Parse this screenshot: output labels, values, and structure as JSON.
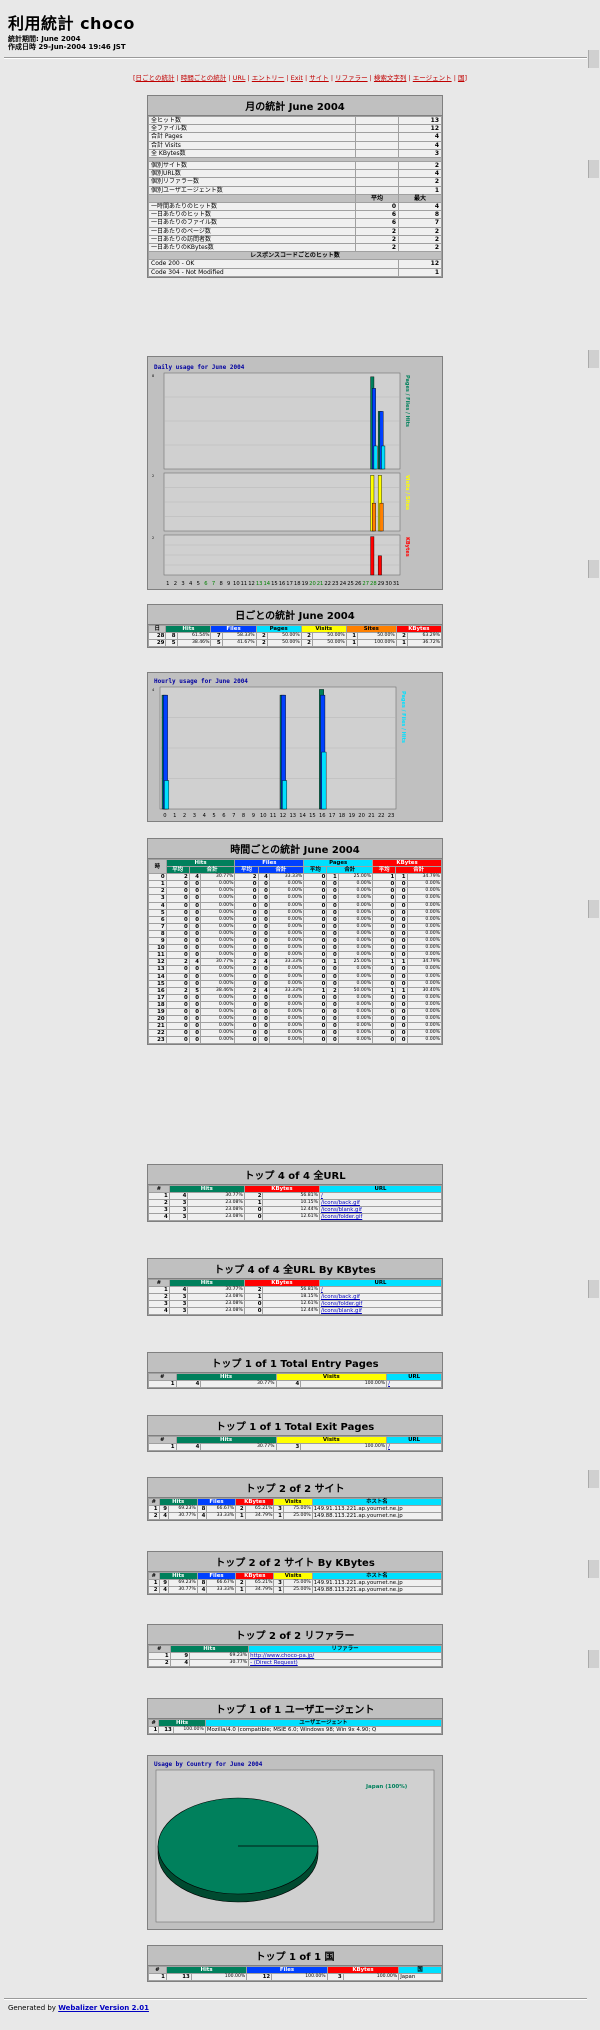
{
  "title": "利用統計 choco",
  "period_label": "統計期間: June 2004",
  "generated_label": "作成日時 29-Jun-2004 19:46 JST",
  "nav": [
    "日ごとの統計",
    "時間ごとの統計",
    "URL",
    "エントリー",
    "Exit",
    "サイト",
    "リファラー",
    "検索文字列",
    "エージェント",
    "国"
  ],
  "monthly": {
    "title": "月の統計 June 2004",
    "totals": [
      {
        "label": "全ヒット数",
        "value": "13"
      },
      {
        "label": "全ファイル数",
        "value": "12"
      },
      {
        "label": "合計 Pages",
        "value": "4"
      },
      {
        "label": "合計 Visits",
        "value": "4"
      },
      {
        "label": "全 KBytes数",
        "value": "3"
      }
    ],
    "uniques": [
      {
        "label": "個別サイト数",
        "value": "2"
      },
      {
        "label": "個別URL数",
        "value": "4"
      },
      {
        "label": "個別リファラー数",
        "value": "2"
      },
      {
        "label": "個別ユーザエージェント数",
        "value": "1"
      }
    ],
    "avg_header": "平均",
    "max_header": "最大",
    "averages": [
      {
        "label": "一時間あたりのヒット数",
        "avg": "0",
        "max": "4"
      },
      {
        "label": "一日あたりのヒット数",
        "avg": "6",
        "max": "8"
      },
      {
        "label": "一日あたりのファイル数",
        "avg": "6",
        "max": "7"
      },
      {
        "label": "一日あたりのページ数",
        "avg": "2",
        "max": "2"
      },
      {
        "label": "一日あたりの訪問者数",
        "avg": "2",
        "max": "2"
      },
      {
        "label": "一日あたりのKBytes数",
        "avg": "2",
        "max": "2"
      }
    ],
    "response_header": "レスポンスコードごとのヒット数",
    "responses": [
      {
        "label": "Code 200 - OK",
        "value": "12"
      },
      {
        "label": "Code 304 - Not Modified",
        "value": "1"
      }
    ]
  },
  "daily_chart": {
    "title": "Daily usage for June 2004",
    "days": [
      "1",
      "2",
      "3",
      "4",
      "5",
      "6",
      "7",
      "8",
      "9",
      "10",
      "11",
      "12",
      "13",
      "14",
      "15",
      "16",
      "17",
      "18",
      "19",
      "20",
      "21",
      "22",
      "23",
      "24",
      "25",
      "26",
      "27",
      "28",
      "29",
      "30",
      "31"
    ],
    "right_labels_top": "Pages / Files / Hits",
    "right_labels_mid": "Visits / Sites",
    "right_labels_bot": "KBytes",
    "ymax_top": "8",
    "ymax_mid": "2",
    "ymax_bot": "2"
  },
  "chart_data": [
    {
      "type": "bar",
      "title": "Daily usage for June 2004",
      "categories": [
        "1",
        "2",
        "3",
        "4",
        "5",
        "6",
        "7",
        "8",
        "9",
        "10",
        "11",
        "12",
        "13",
        "14",
        "15",
        "16",
        "17",
        "18",
        "19",
        "20",
        "21",
        "22",
        "23",
        "24",
        "25",
        "26",
        "27",
        "28",
        "29",
        "30",
        "31"
      ],
      "series": [
        {
          "name": "Hits",
          "values": [
            0,
            0,
            0,
            0,
            0,
            0,
            0,
            0,
            0,
            0,
            0,
            0,
            0,
            0,
            0,
            0,
            0,
            0,
            0,
            0,
            0,
            0,
            0,
            0,
            0,
            0,
            0,
            8,
            5,
            0,
            0
          ]
        },
        {
          "name": "Files",
          "values": [
            0,
            0,
            0,
            0,
            0,
            0,
            0,
            0,
            0,
            0,
            0,
            0,
            0,
            0,
            0,
            0,
            0,
            0,
            0,
            0,
            0,
            0,
            0,
            0,
            0,
            0,
            0,
            7,
            5,
            0,
            0
          ]
        },
        {
          "name": "Pages",
          "values": [
            0,
            0,
            0,
            0,
            0,
            0,
            0,
            0,
            0,
            0,
            0,
            0,
            0,
            0,
            0,
            0,
            0,
            0,
            0,
            0,
            0,
            0,
            0,
            0,
            0,
            0,
            0,
            2,
            2,
            0,
            0
          ]
        },
        {
          "name": "Visits",
          "values": [
            0,
            0,
            0,
            0,
            0,
            0,
            0,
            0,
            0,
            0,
            0,
            0,
            0,
            0,
            0,
            0,
            0,
            0,
            0,
            0,
            0,
            0,
            0,
            0,
            0,
            0,
            0,
            2,
            2,
            0,
            0
          ]
        },
        {
          "name": "Sites",
          "values": [
            0,
            0,
            0,
            0,
            0,
            0,
            0,
            0,
            0,
            0,
            0,
            0,
            0,
            0,
            0,
            0,
            0,
            0,
            0,
            0,
            0,
            0,
            0,
            0,
            0,
            0,
            0,
            1,
            1,
            0,
            0
          ]
        },
        {
          "name": "KBytes",
          "values": [
            0,
            0,
            0,
            0,
            0,
            0,
            0,
            0,
            0,
            0,
            0,
            0,
            0,
            0,
            0,
            0,
            0,
            0,
            0,
            0,
            0,
            0,
            0,
            0,
            0,
            0,
            0,
            2,
            1,
            0,
            0
          ]
        }
      ]
    },
    {
      "type": "bar",
      "title": "Hourly usage for June 2004",
      "categories": [
        "0",
        "1",
        "2",
        "3",
        "4",
        "5",
        "6",
        "7",
        "8",
        "9",
        "10",
        "11",
        "12",
        "13",
        "14",
        "15",
        "16",
        "17",
        "18",
        "19",
        "20",
        "21",
        "22",
        "23"
      ],
      "ylim": [
        0,
        4
      ],
      "series": [
        {
          "name": "Hits",
          "values": [
            4,
            0,
            0,
            0,
            0,
            0,
            0,
            0,
            0,
            0,
            0,
            0,
            4,
            0,
            0,
            0,
            5,
            0,
            0,
            0,
            0,
            0,
            0,
            0
          ]
        },
        {
          "name": "Files",
          "values": [
            4,
            0,
            0,
            0,
            0,
            0,
            0,
            0,
            0,
            0,
            0,
            0,
            4,
            0,
            0,
            0,
            4,
            0,
            0,
            0,
            0,
            0,
            0,
            0
          ]
        },
        {
          "name": "Pages",
          "values": [
            1,
            0,
            0,
            0,
            0,
            0,
            0,
            0,
            0,
            0,
            0,
            0,
            1,
            0,
            0,
            0,
            2,
            0,
            0,
            0,
            0,
            0,
            0,
            0
          ]
        }
      ]
    },
    {
      "type": "pie",
      "title": "Usage by Country for June 2004",
      "categories": [
        "Japan"
      ],
      "values": [
        100
      ],
      "legend": "Japan (100%)"
    }
  ],
  "hourly_chart": {
    "title": "Hourly usage for June 2004",
    "ymax": "4",
    "right_labels": "Pages / Files / Hits"
  },
  "daily_table": {
    "title": "日ごとの統計 June 2004",
    "headers": {
      "day": "日",
      "hits": "Hits",
      "files": "Files",
      "pages": "Pages",
      "visits": "Visits",
      "sites": "Sites",
      "kb": "KBytes"
    },
    "rows": [
      [
        "28",
        "8",
        "61.54%",
        "7",
        "58.33%",
        "2",
        "50.00%",
        "2",
        "50.00%",
        "1",
        "50.00%",
        "2",
        "63.29%"
      ],
      [
        "29",
        "5",
        "38.46%",
        "5",
        "41.67%",
        "2",
        "50.00%",
        "2",
        "50.00%",
        "1",
        "100.00%",
        "1",
        "36.72%"
      ]
    ]
  },
  "hourly_table": {
    "title": "時間ごとの統計 June 2004",
    "headers": {
      "hour": "時",
      "hits": "Hits",
      "files": "Files",
      "pages": "Pages",
      "kb": "KBytes",
      "avg": "平均",
      "total": "合計"
    },
    "rows": [
      [
        "0",
        "2",
        "4",
        "30.77%",
        "2",
        "4",
        "33.33%",
        "0",
        "1",
        "25.00%",
        "1",
        "1",
        "34.79%"
      ],
      [
        "1",
        "0",
        "0",
        "0.00%",
        "0",
        "0",
        "0.00%",
        "0",
        "0",
        "0.00%",
        "0",
        "0",
        "0.00%"
      ],
      [
        "2",
        "0",
        "0",
        "0.00%",
        "0",
        "0",
        "0.00%",
        "0",
        "0",
        "0.00%",
        "0",
        "0",
        "0.00%"
      ],
      [
        "3",
        "0",
        "0",
        "0.00%",
        "0",
        "0",
        "0.00%",
        "0",
        "0",
        "0.00%",
        "0",
        "0",
        "0.00%"
      ],
      [
        "4",
        "0",
        "0",
        "0.00%",
        "0",
        "0",
        "0.00%",
        "0",
        "0",
        "0.00%",
        "0",
        "0",
        "0.00%"
      ],
      [
        "5",
        "0",
        "0",
        "0.00%",
        "0",
        "0",
        "0.00%",
        "0",
        "0",
        "0.00%",
        "0",
        "0",
        "0.00%"
      ],
      [
        "6",
        "0",
        "0",
        "0.00%",
        "0",
        "0",
        "0.00%",
        "0",
        "0",
        "0.00%",
        "0",
        "0",
        "0.00%"
      ],
      [
        "7",
        "0",
        "0",
        "0.00%",
        "0",
        "0",
        "0.00%",
        "0",
        "0",
        "0.00%",
        "0",
        "0",
        "0.00%"
      ],
      [
        "8",
        "0",
        "0",
        "0.00%",
        "0",
        "0",
        "0.00%",
        "0",
        "0",
        "0.00%",
        "0",
        "0",
        "0.00%"
      ],
      [
        "9",
        "0",
        "0",
        "0.00%",
        "0",
        "0",
        "0.00%",
        "0",
        "0",
        "0.00%",
        "0",
        "0",
        "0.00%"
      ],
      [
        "10",
        "0",
        "0",
        "0.00%",
        "0",
        "0",
        "0.00%",
        "0",
        "0",
        "0.00%",
        "0",
        "0",
        "0.00%"
      ],
      [
        "11",
        "0",
        "0",
        "0.00%",
        "0",
        "0",
        "0.00%",
        "0",
        "0",
        "0.00%",
        "0",
        "0",
        "0.00%"
      ],
      [
        "12",
        "2",
        "4",
        "30.77%",
        "2",
        "4",
        "33.33%",
        "0",
        "1",
        "25.00%",
        "1",
        "1",
        "34.79%"
      ],
      [
        "13",
        "0",
        "0",
        "0.00%",
        "0",
        "0",
        "0.00%",
        "0",
        "0",
        "0.00%",
        "0",
        "0",
        "0.00%"
      ],
      [
        "14",
        "0",
        "0",
        "0.00%",
        "0",
        "0",
        "0.00%",
        "0",
        "0",
        "0.00%",
        "0",
        "0",
        "0.00%"
      ],
      [
        "15",
        "0",
        "0",
        "0.00%",
        "0",
        "0",
        "0.00%",
        "0",
        "0",
        "0.00%",
        "0",
        "0",
        "0.00%"
      ],
      [
        "16",
        "2",
        "5",
        "38.46%",
        "2",
        "4",
        "33.33%",
        "1",
        "2",
        "50.00%",
        "1",
        "1",
        "30.40%"
      ],
      [
        "17",
        "0",
        "0",
        "0.00%",
        "0",
        "0",
        "0.00%",
        "0",
        "0",
        "0.00%",
        "0",
        "0",
        "0.00%"
      ],
      [
        "18",
        "0",
        "0",
        "0.00%",
        "0",
        "0",
        "0.00%",
        "0",
        "0",
        "0.00%",
        "0",
        "0",
        "0.00%"
      ],
      [
        "19",
        "0",
        "0",
        "0.00%",
        "0",
        "0",
        "0.00%",
        "0",
        "0",
        "0.00%",
        "0",
        "0",
        "0.00%"
      ],
      [
        "20",
        "0",
        "0",
        "0.00%",
        "0",
        "0",
        "0.00%",
        "0",
        "0",
        "0.00%",
        "0",
        "0",
        "0.00%"
      ],
      [
        "21",
        "0",
        "0",
        "0.00%",
        "0",
        "0",
        "0.00%",
        "0",
        "0",
        "0.00%",
        "0",
        "0",
        "0.00%"
      ],
      [
        "22",
        "0",
        "0",
        "0.00%",
        "0",
        "0",
        "0.00%",
        "0",
        "0",
        "0.00%",
        "0",
        "0",
        "0.00%"
      ],
      [
        "23",
        "0",
        "0",
        "0.00%",
        "0",
        "0",
        "0.00%",
        "0",
        "0",
        "0.00%",
        "0",
        "0",
        "0.00%"
      ]
    ]
  },
  "top_url": {
    "title": "トップ 4 of 4 全URL",
    "headers": {
      "n": "#",
      "hits": "Hits",
      "kb": "KBytes",
      "url": "URL"
    },
    "rows": [
      [
        "1",
        "4",
        "30.77%",
        "2",
        "56.81%",
        "/"
      ],
      [
        "2",
        "3",
        "23.08%",
        "1",
        "10.15%",
        "/icons/back.gif"
      ],
      [
        "3",
        "3",
        "23.08%",
        "0",
        "12.44%",
        "/icons/blank.gif"
      ],
      [
        "4",
        "3",
        "23.08%",
        "0",
        "12.61%",
        "/icons/folder.gif"
      ]
    ]
  },
  "top_url_kb": {
    "title": "トップ 4 of 4 全URL By KBytes",
    "headers": {
      "n": "#",
      "hits": "Hits",
      "kb": "KBytes",
      "url": "URL"
    },
    "rows": [
      [
        "1",
        "4",
        "30.77%",
        "2",
        "56.81%",
        "/"
      ],
      [
        "2",
        "3",
        "23.08%",
        "1",
        "18.15%",
        "/icons/back.gif"
      ],
      [
        "3",
        "3",
        "23.08%",
        "0",
        "12.61%",
        "/icons/folder.gif"
      ],
      [
        "4",
        "3",
        "23.08%",
        "0",
        "12.44%",
        "/icons/blank.gif"
      ]
    ]
  },
  "entry": {
    "title": "トップ 1 of 1 Total Entry Pages",
    "headers": {
      "n": "#",
      "hits": "Hits",
      "visits": "Visits",
      "url": "URL"
    },
    "rows": [
      [
        "1",
        "4",
        "30.77%",
        "4",
        "100.00%",
        "/"
      ]
    ]
  },
  "exit": {
    "title": "トップ 1 of 1 Total Exit Pages",
    "headers": {
      "n": "#",
      "hits": "Hits",
      "visits": "Visits",
      "url": "URL"
    },
    "rows": [
      [
        "1",
        "4",
        "30.77%",
        "3",
        "100.00%",
        "/"
      ]
    ]
  },
  "sites": {
    "title": "トップ 2 of 2 サイト",
    "headers": {
      "n": "#",
      "hits": "Hits",
      "files": "Files",
      "kb": "KBytes",
      "visits": "Visits",
      "host": "ホスト名"
    },
    "rows": [
      [
        "1",
        "9",
        "69.23%",
        "8",
        "66.67%",
        "2",
        "65.21%",
        "3",
        "75.00%",
        "149.91.113.221.ap.yournet.ne.jp"
      ],
      [
        "2",
        "4",
        "30.77%",
        "4",
        "33.33%",
        "1",
        "34.79%",
        "1",
        "25.00%",
        "149.88.113.221.ap.yournet.ne.jp"
      ]
    ]
  },
  "sites_kb": {
    "title": "トップ 2 of 2 サイト By KBytes",
    "headers": {
      "n": "#",
      "hits": "Hits",
      "files": "Files",
      "kb": "KBytes",
      "visits": "Visits",
      "host": "ホスト名"
    },
    "rows": [
      [
        "1",
        "9",
        "69.23%",
        "8",
        "66.67%",
        "2",
        "65.21%",
        "3",
        "75.00%",
        "149.91.113.221.ap.yournet.ne.jp"
      ],
      [
        "2",
        "4",
        "30.77%",
        "4",
        "33.33%",
        "1",
        "34.79%",
        "1",
        "25.00%",
        "149.88.113.221.ap.yournet.ne.jp"
      ]
    ]
  },
  "referrers": {
    "title": "トップ 2 of 2 リファラー",
    "headers": {
      "n": "#",
      "hits": "Hits",
      "ref": "リファラー"
    },
    "rows": [
      [
        "1",
        "9",
        "69.23%",
        "http://www.choco-pa.jp/"
      ],
      [
        "2",
        "4",
        "30.77%",
        "- (Direct Request)"
      ]
    ]
  },
  "agents": {
    "title": "トップ 1 of 1 ユーザエージェント",
    "headers": {
      "n": "#",
      "hits": "Hits",
      "agent": "ユーザエージェント"
    },
    "rows": [
      [
        "1",
        "13",
        "100.00%",
        "Mozilla/4.0 (compatible; MSIE 6.0; Windows 98; Win 9x 4.90; Q"
      ]
    ]
  },
  "country_chart": {
    "title": "Usage by Country for June 2004",
    "legend": "Japan (100%)"
  },
  "country": {
    "title": "トップ 1 of 1 国",
    "headers": {
      "n": "#",
      "hits": "Hits",
      "files": "Files",
      "kb": "KBytes",
      "country": "国"
    },
    "rows": [
      [
        "1",
        "13",
        "100.00%",
        "12",
        "100.00%",
        "3",
        "100.00%",
        "Japan"
      ]
    ]
  },
  "footer": {
    "prefix": "Generated by ",
    "link": "Webalizer Version 2.01"
  },
  "colors": {
    "hits": "#00805c",
    "files": "#0040ff",
    "pages": "#00e0ff",
    "visits": "#ffff00",
    "sites": "#ff8000",
    "kbytes": "#ff0000"
  }
}
